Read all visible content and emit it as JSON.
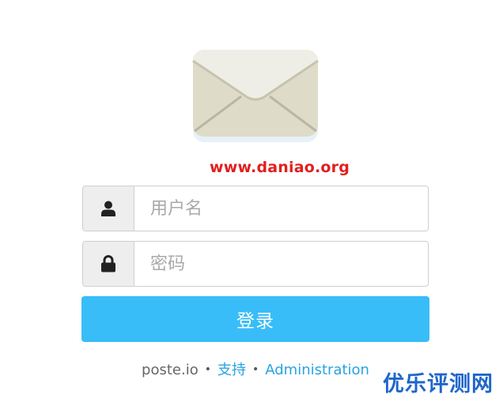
{
  "logo": {
    "icon": "envelope-icon"
  },
  "watermark_top": "www.daniao.org",
  "username": {
    "icon": "user-icon",
    "placeholder": "用户名",
    "value": ""
  },
  "password": {
    "icon": "lock-icon",
    "placeholder": "密码",
    "value": ""
  },
  "login_button": {
    "label": "登录",
    "color": "#38bdf8"
  },
  "footer": {
    "brand": "poste.io",
    "separator": "•",
    "support_link": "支持",
    "admin_link": "Administration"
  },
  "watermark_bottom": "优乐评测网"
}
